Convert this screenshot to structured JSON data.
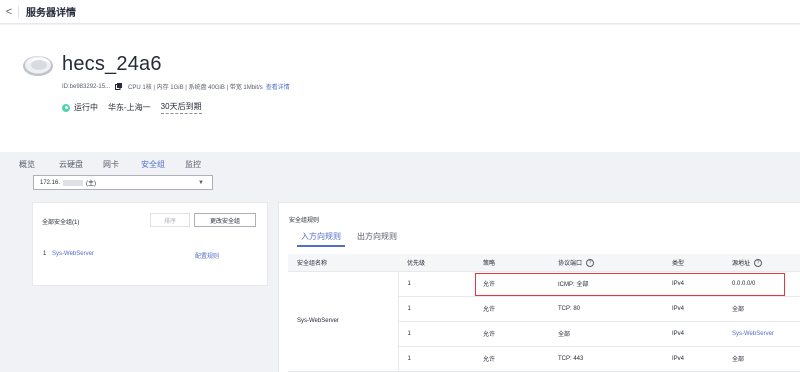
{
  "header": {
    "back_glyph": "<",
    "title": "服务器详情"
  },
  "server": {
    "name": "hecs_24a6",
    "id_text": "ID:be983292-15...",
    "specs": "CPU 1核 | 内存 1GiB | 系统盘 40GiB | 带宽 1Mbit/s",
    "details_link": "查看详情",
    "status": "运行中",
    "region": "华东-上海一",
    "expiry": "30天后到期"
  },
  "tabs": [
    {
      "label": "概览"
    },
    {
      "label": "云硬盘"
    },
    {
      "label": "网卡"
    },
    {
      "label": "安全组",
      "active": true
    },
    {
      "label": "监控"
    }
  ],
  "nic_select": {
    "prefix": "172.16.",
    "suffix": "(主)",
    "arrow": "▼"
  },
  "left_panel": {
    "title": "全部安全组(1)",
    "sort_button": "排序",
    "change_button": "更改安全组",
    "row_index": "1",
    "row_group": "Sys-WebServer",
    "row_config": "配置规则"
  },
  "right_panel": {
    "title": "安全组规则",
    "sub_tabs": [
      "入方向规则",
      "出方向规则"
    ],
    "columns": [
      "安全组名称",
      "优先级",
      "策略",
      "协议端口",
      "类型",
      "源地址"
    ],
    "help_glyph": "?",
    "group_name": "Sys-WebServer",
    "rows": [
      {
        "priority": "1",
        "policy": "允许",
        "port": "ICMP: 全部",
        "type": "IPv4",
        "source": "0.0.0.0/0"
      },
      {
        "priority": "1",
        "policy": "允许",
        "port": "TCP: 80",
        "type": "IPv4",
        "source": "全部"
      },
      {
        "priority": "1",
        "policy": "允许",
        "port": "全部",
        "type": "IPv4",
        "source": "Sys-WebServer"
      },
      {
        "priority": "1",
        "policy": "允许",
        "port": "TCP: 443",
        "type": "IPv4",
        "source": "全部"
      }
    ]
  },
  "colors": {
    "accent": "#526ecc",
    "status_running": "#50d4ab",
    "highlight": "#e8353e"
  }
}
